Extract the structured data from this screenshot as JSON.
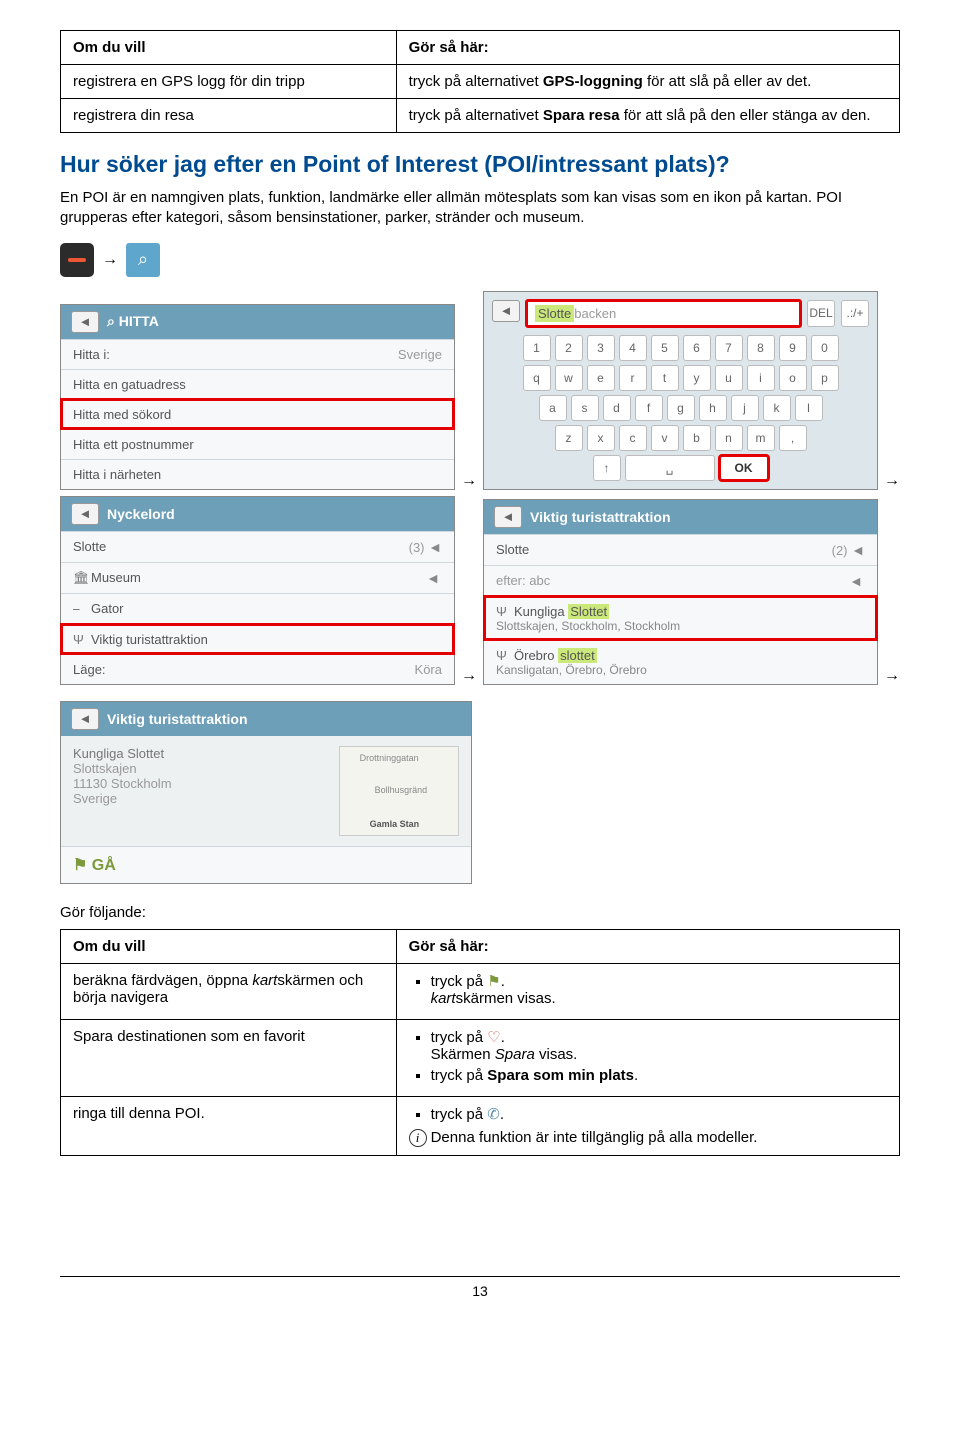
{
  "table1": {
    "h_left": "Om du vill",
    "h_right": "Gör så här:",
    "r1_left": "registrera en GPS logg för din tripp",
    "r1_right_pre": "tryck på alternativet ",
    "r1_right_bold": "GPS-loggning",
    "r1_right_post": " för att slå på eller av det.",
    "r2_left": "registrera din resa",
    "r2_right_pre": "tryck på alternativet ",
    "r2_right_bold": "Spara resa",
    "r2_right_post": " för att slå på den eller stänga av den."
  },
  "section_title": "Hur söker jag efter en Point of Interest (POI/intressant plats)?",
  "section_body": "En POI är en namngiven plats, funktion, landmärke eller allmän mötesplats som kan visas som en ikon på kartan. POI grupperas efter kategori, såsom bensinstationer, parker, stränder och museum.",
  "arrow": "→",
  "shot_hitta": {
    "title": "HITTA",
    "rows": {
      "a": "Hitta i:",
      "a_val": "Sverige",
      "b": "Hitta en gatuadress",
      "c": "Hitta med sökord",
      "d": "Hitta ett postnummer",
      "e": "Hitta i närheten"
    }
  },
  "shot_keyb": {
    "typed": "Slotte",
    "placeholder": "backen",
    "del": "DEL",
    "punct": ".:/+ ",
    "ok": "OK",
    "rows": [
      [
        "1",
        "2",
        "3",
        "4",
        "5",
        "6",
        "7",
        "8",
        "9",
        "0"
      ],
      [
        "q",
        "w",
        "e",
        "r",
        "t",
        "y",
        "u",
        "i",
        "o",
        "p"
      ],
      [
        "a",
        "s",
        "d",
        "f",
        "g",
        "h",
        "j",
        "k",
        "l"
      ],
      [
        "z",
        "x",
        "c",
        "v",
        "b",
        "n",
        "m",
        ","
      ]
    ]
  },
  "shot_nyckel": {
    "title": "Nyckelord",
    "slotte": "Slotte",
    "slotte_n": "(3)",
    "museum": "Museum",
    "gator": "Gator",
    "vta": "Viktig turistattraktion",
    "lage": "Läge:",
    "lage_val": "Köra"
  },
  "shot_vta": {
    "title": "Viktig turistattraktion",
    "slotte": "Slotte",
    "slotte_n": "(2)",
    "efter": "efter: abc",
    "l1": "Kungliga ",
    "l1hl": "Slottet",
    "l1sub": "Slottskajen, Stockholm, Stockholm",
    "l2": "Örebro ",
    "l2hl": "slottet",
    "l2sub": "Kansligatan, Örebro, Örebro"
  },
  "shot_final": {
    "title": "Viktig turistattraktion",
    "l1": "Kungliga Slottet",
    "l2": "Slottskajen",
    "l3": "11130 Stockholm",
    "l4": "Sverige",
    "go": "GÅ",
    "m1": "Drottninggatan",
    "m2": "Bollhusgränd",
    "m3": "Gamla Stan"
  },
  "gor_foljande": "Gör följande:",
  "table2": {
    "h_left": "Om du vill",
    "h_right": "Gör så här:",
    "r1_left_a": "beräkna färdvägen, öppna ",
    "r1_left_it": "kart",
    "r1_left_b": "skärmen och börja navigera",
    "r1_right_a": "tryck på ",
    "r1_right_b_it": "kart",
    "r1_right_b": "skärmen visas.",
    "r2_left": "Spara destinationen som en favorit",
    "r2_li1": "tryck på ",
    "r2_li1b_pre": "Skärmen ",
    "r2_li1b_it": "Spara",
    "r2_li1b_post": " visas.",
    "r2_li2_pre": "tryck på ",
    "r2_li2_bold": "Spara som min plats",
    "r3_left": "ringa till denna POI.",
    "r3_li": "tryck på ",
    "r3_note": "Denna funktion är inte tillgänglig på alla modeller."
  },
  "page_number": "13"
}
